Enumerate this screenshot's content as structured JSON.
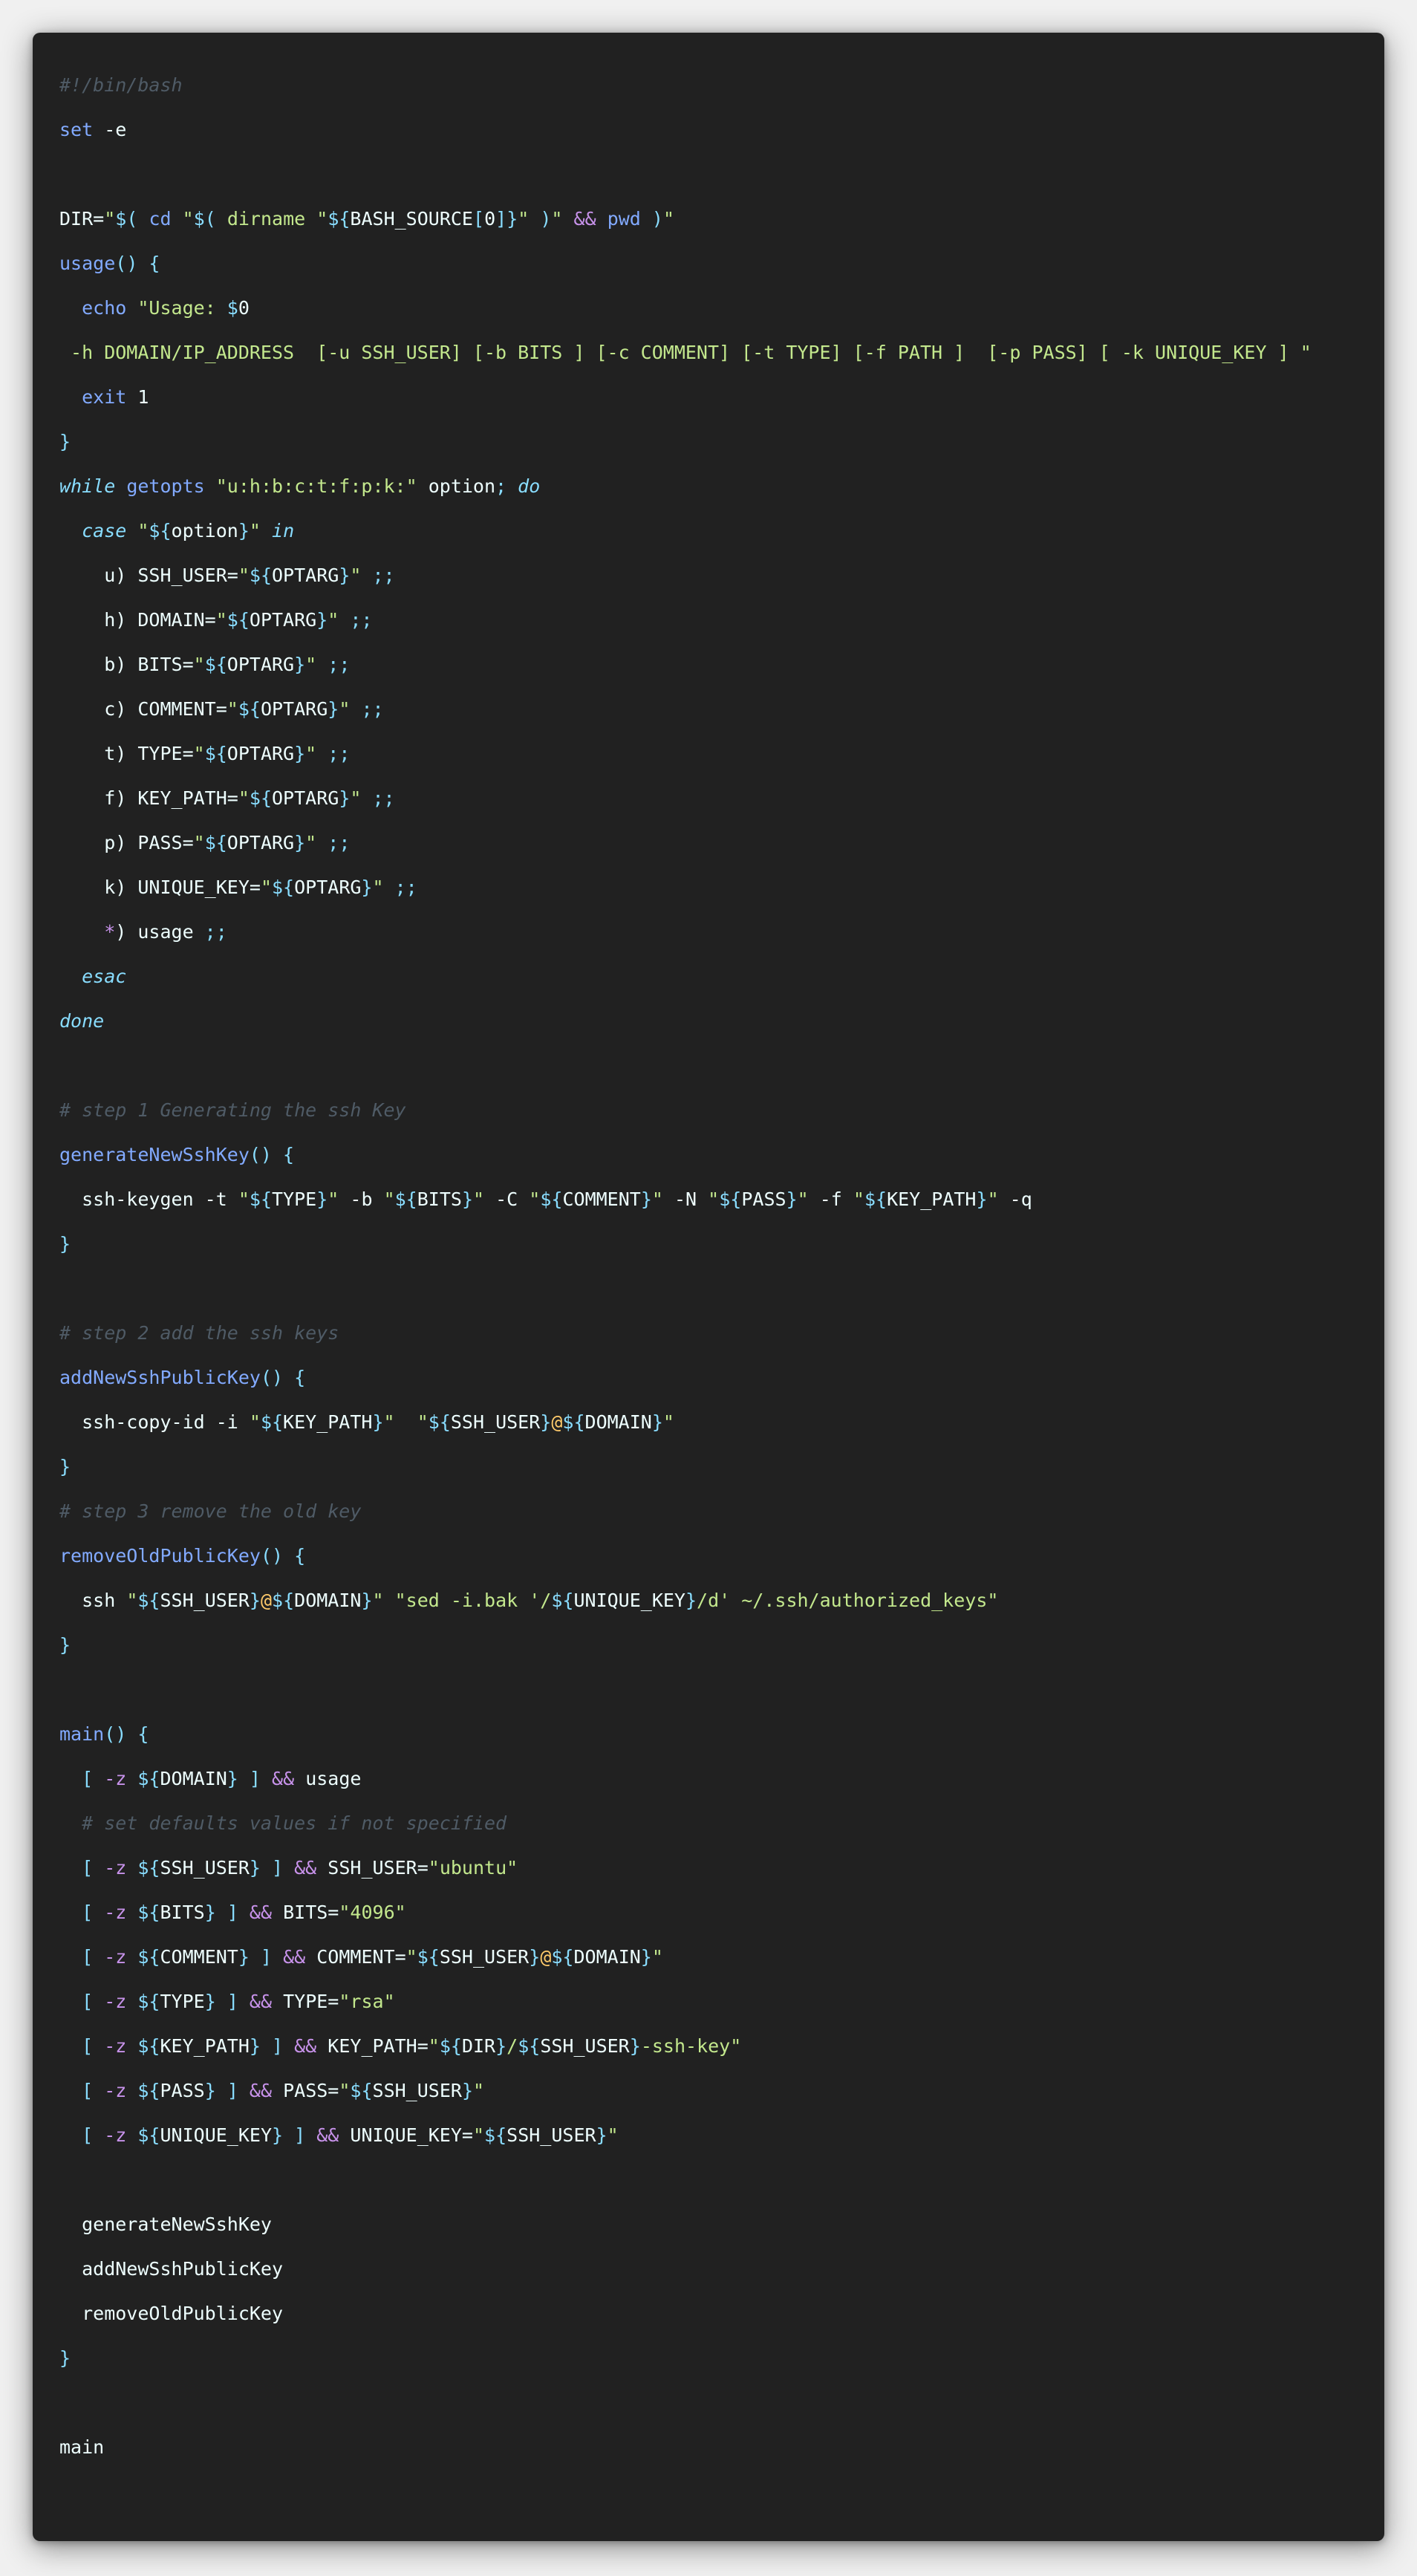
{
  "theme": {
    "background": "#f0f0f0",
    "editor_background": "#212121",
    "plain": "#eeffff",
    "comment": "#4f5b66",
    "keyword": "#89ddff",
    "function": "#82aaff",
    "string": "#c3e88d",
    "variable": "#89ddff",
    "operator": "#c792ea",
    "at_sign": "#ffcb6b"
  },
  "code_lines": [
    [
      [
        "comment",
        "#!/bin/bash"
      ]
    ],
    [
      [
        "func",
        "set"
      ],
      [
        "plain",
        " -e"
      ]
    ],
    [],
    [
      [
        "plain",
        "DIR="
      ],
      [
        "string",
        "\""
      ],
      [
        "var",
        "$("
      ],
      [
        "func",
        " cd "
      ],
      [
        "string",
        "\""
      ],
      [
        "var",
        "$("
      ],
      [
        "string",
        " dirname "
      ],
      [
        "string",
        "\""
      ],
      [
        "var",
        "${"
      ],
      [
        "plain",
        "BASH_SOURCE"
      ],
      [
        "punct",
        "["
      ],
      [
        "plain",
        "0"
      ],
      [
        "punct",
        "]"
      ],
      [
        "var",
        "}"
      ],
      [
        "string",
        "\""
      ],
      [
        "var",
        " )"
      ],
      [
        "string",
        "\""
      ],
      [
        "op",
        " && "
      ],
      [
        "func",
        "pwd"
      ],
      [
        "var",
        " )"
      ],
      [
        "string",
        "\""
      ]
    ],
    [
      [
        "func",
        "usage"
      ],
      [
        "punct",
        "() {"
      ]
    ],
    [
      [
        "func",
        "  echo"
      ],
      [
        "string",
        " \"Usage: "
      ],
      [
        "var",
        "$"
      ],
      [
        "plain",
        "0"
      ]
    ],
    [
      [
        "string",
        " -h DOMAIN/IP_ADDRESS  [-u SSH_USER] [-b BITS ] [-c COMMENT] [-t TYPE] [-f PATH ]  [-p PASS] [ -k UNIQUE_KEY ] \""
      ]
    ],
    [
      [
        "func",
        "  exit"
      ],
      [
        "plain",
        " 1"
      ]
    ],
    [
      [
        "punct",
        "}"
      ]
    ],
    [
      [
        "keyword",
        "while"
      ],
      [
        "func",
        " getopts"
      ],
      [
        "string",
        " \"u:h:b:c:t:f:p:k:\""
      ],
      [
        "plain",
        " option"
      ],
      [
        "punct",
        ";"
      ],
      [
        "keyword",
        " do"
      ]
    ],
    [
      [
        "keyword",
        "  case"
      ],
      [
        "string",
        " \""
      ],
      [
        "var",
        "${"
      ],
      [
        "plain",
        "option"
      ],
      [
        "var",
        "}"
      ],
      [
        "string",
        "\""
      ],
      [
        "keyword",
        " in"
      ]
    ],
    [
      [
        "plain",
        "    u) SSH_USER="
      ],
      [
        "string",
        "\""
      ],
      [
        "var",
        "${"
      ],
      [
        "plain",
        "OPTARG"
      ],
      [
        "var",
        "}"
      ],
      [
        "string",
        "\""
      ],
      [
        "punct",
        " ;;"
      ]
    ],
    [
      [
        "plain",
        "    h) DOMAIN="
      ],
      [
        "string",
        "\""
      ],
      [
        "var",
        "${"
      ],
      [
        "plain",
        "OPTARG"
      ],
      [
        "var",
        "}"
      ],
      [
        "string",
        "\""
      ],
      [
        "punct",
        " ;;"
      ]
    ],
    [
      [
        "plain",
        "    b) BITS="
      ],
      [
        "string",
        "\""
      ],
      [
        "var",
        "${"
      ],
      [
        "plain",
        "OPTARG"
      ],
      [
        "var",
        "}"
      ],
      [
        "string",
        "\""
      ],
      [
        "punct",
        " ;;"
      ]
    ],
    [
      [
        "plain",
        "    c) COMMENT="
      ],
      [
        "string",
        "\""
      ],
      [
        "var",
        "${"
      ],
      [
        "plain",
        "OPTARG"
      ],
      [
        "var",
        "}"
      ],
      [
        "string",
        "\""
      ],
      [
        "punct",
        " ;;"
      ]
    ],
    [
      [
        "plain",
        "    t) TYPE="
      ],
      [
        "string",
        "\""
      ],
      [
        "var",
        "${"
      ],
      [
        "plain",
        "OPTARG"
      ],
      [
        "var",
        "}"
      ],
      [
        "string",
        "\""
      ],
      [
        "punct",
        " ;;"
      ]
    ],
    [
      [
        "plain",
        "    f) KEY_PATH="
      ],
      [
        "string",
        "\""
      ],
      [
        "var",
        "${"
      ],
      [
        "plain",
        "OPTARG"
      ],
      [
        "var",
        "}"
      ],
      [
        "string",
        "\""
      ],
      [
        "punct",
        " ;;"
      ]
    ],
    [
      [
        "plain",
        "    p) PASS="
      ],
      [
        "string",
        "\""
      ],
      [
        "var",
        "${"
      ],
      [
        "plain",
        "OPTARG"
      ],
      [
        "var",
        "}"
      ],
      [
        "string",
        "\""
      ],
      [
        "punct",
        " ;;"
      ]
    ],
    [
      [
        "plain",
        "    k) UNIQUE_KEY="
      ],
      [
        "string",
        "\""
      ],
      [
        "var",
        "${"
      ],
      [
        "plain",
        "OPTARG"
      ],
      [
        "var",
        "}"
      ],
      [
        "string",
        "\""
      ],
      [
        "punct",
        " ;;"
      ]
    ],
    [
      [
        "op",
        "    *"
      ],
      [
        "plain",
        ") usage"
      ],
      [
        "punct",
        " ;;"
      ]
    ],
    [
      [
        "keyword",
        "  esac"
      ]
    ],
    [
      [
        "keyword",
        "done"
      ]
    ],
    [],
    [
      [
        "comment",
        "# step 1 Generating the ssh Key"
      ]
    ],
    [
      [
        "func",
        "generateNewSshKey"
      ],
      [
        "punct",
        "() {"
      ]
    ],
    [
      [
        "plain",
        "  ssh-keygen -t "
      ],
      [
        "string",
        "\""
      ],
      [
        "var",
        "${"
      ],
      [
        "plain",
        "TYPE"
      ],
      [
        "var",
        "}"
      ],
      [
        "string",
        "\""
      ],
      [
        "plain",
        " -b "
      ],
      [
        "string",
        "\""
      ],
      [
        "var",
        "${"
      ],
      [
        "plain",
        "BITS"
      ],
      [
        "var",
        "}"
      ],
      [
        "string",
        "\""
      ],
      [
        "plain",
        " -C "
      ],
      [
        "string",
        "\""
      ],
      [
        "var",
        "${"
      ],
      [
        "plain",
        "COMMENT"
      ],
      [
        "var",
        "}"
      ],
      [
        "string",
        "\""
      ],
      [
        "plain",
        " -N "
      ],
      [
        "string",
        "\""
      ],
      [
        "var",
        "${"
      ],
      [
        "plain",
        "PASS"
      ],
      [
        "var",
        "}"
      ],
      [
        "string",
        "\""
      ],
      [
        "plain",
        " -f "
      ],
      [
        "string",
        "\""
      ],
      [
        "var",
        "${"
      ],
      [
        "plain",
        "KEY_PATH"
      ],
      [
        "var",
        "}"
      ],
      [
        "string",
        "\""
      ],
      [
        "plain",
        " -q"
      ]
    ],
    [
      [
        "punct",
        "}"
      ]
    ],
    [],
    [
      [
        "comment",
        "# step 2 add the ssh keys"
      ]
    ],
    [
      [
        "func",
        "addNewSshPublicKey"
      ],
      [
        "punct",
        "() {"
      ]
    ],
    [
      [
        "plain",
        "  ssh-copy-id -i "
      ],
      [
        "string",
        "\""
      ],
      [
        "var",
        "${"
      ],
      [
        "plain",
        "KEY_PATH"
      ],
      [
        "var",
        "}"
      ],
      [
        "string",
        "\""
      ],
      [
        "plain",
        "  "
      ],
      [
        "string",
        "\""
      ],
      [
        "var",
        "${"
      ],
      [
        "plain",
        "SSH_USER"
      ],
      [
        "var",
        "}"
      ],
      [
        "at",
        "@"
      ],
      [
        "var",
        "${"
      ],
      [
        "plain",
        "DOMAIN"
      ],
      [
        "var",
        "}"
      ],
      [
        "string",
        "\""
      ]
    ],
    [
      [
        "punct",
        "}"
      ]
    ],
    [
      [
        "comment",
        "# step 3 remove the old key"
      ]
    ],
    [
      [
        "func",
        "removeOldPublicKey"
      ],
      [
        "punct",
        "() {"
      ]
    ],
    [
      [
        "plain",
        "  ssh "
      ],
      [
        "string",
        "\""
      ],
      [
        "var",
        "${"
      ],
      [
        "plain",
        "SSH_USER"
      ],
      [
        "var",
        "}"
      ],
      [
        "at",
        "@"
      ],
      [
        "var",
        "${"
      ],
      [
        "plain",
        "DOMAIN"
      ],
      [
        "var",
        "}"
      ],
      [
        "string",
        "\""
      ],
      [
        "string",
        " \"sed -i.bak '/"
      ],
      [
        "var",
        "${"
      ],
      [
        "plain",
        "UNIQUE_KEY"
      ],
      [
        "var",
        "}"
      ],
      [
        "string",
        "/d' ~/.ssh/authorized_keys\""
      ]
    ],
    [
      [
        "punct",
        "}"
      ]
    ],
    [],
    [
      [
        "func",
        "main"
      ],
      [
        "punct",
        "() {"
      ]
    ],
    [
      [
        "punct",
        "  ["
      ],
      [
        "op",
        " -z "
      ],
      [
        "var",
        "${"
      ],
      [
        "plain",
        "DOMAIN"
      ],
      [
        "var",
        "}"
      ],
      [
        "punct",
        " ]"
      ],
      [
        "op",
        " && "
      ],
      [
        "plain",
        "usage"
      ]
    ],
    [
      [
        "comment",
        "  # set defaults values if not specified"
      ]
    ],
    [
      [
        "punct",
        "  ["
      ],
      [
        "op",
        " -z "
      ],
      [
        "var",
        "${"
      ],
      [
        "plain",
        "SSH_USER"
      ],
      [
        "var",
        "}"
      ],
      [
        "punct",
        " ]"
      ],
      [
        "op",
        " && "
      ],
      [
        "plain",
        "SSH_USER="
      ],
      [
        "string",
        "\"ubuntu\""
      ]
    ],
    [
      [
        "punct",
        "  ["
      ],
      [
        "op",
        " -z "
      ],
      [
        "var",
        "${"
      ],
      [
        "plain",
        "BITS"
      ],
      [
        "var",
        "}"
      ],
      [
        "punct",
        " ]"
      ],
      [
        "op",
        " && "
      ],
      [
        "plain",
        "BITS="
      ],
      [
        "string",
        "\"4096\""
      ]
    ],
    [
      [
        "punct",
        "  ["
      ],
      [
        "op",
        " -z "
      ],
      [
        "var",
        "${"
      ],
      [
        "plain",
        "COMMENT"
      ],
      [
        "var",
        "}"
      ],
      [
        "punct",
        " ]"
      ],
      [
        "op",
        " && "
      ],
      [
        "plain",
        "COMMENT="
      ],
      [
        "string",
        "\""
      ],
      [
        "var",
        "${"
      ],
      [
        "plain",
        "SSH_USER"
      ],
      [
        "var",
        "}"
      ],
      [
        "at",
        "@"
      ],
      [
        "var",
        "${"
      ],
      [
        "plain",
        "DOMAIN"
      ],
      [
        "var",
        "}"
      ],
      [
        "string",
        "\""
      ]
    ],
    [
      [
        "punct",
        "  ["
      ],
      [
        "op",
        " -z "
      ],
      [
        "var",
        "${"
      ],
      [
        "plain",
        "TYPE"
      ],
      [
        "var",
        "}"
      ],
      [
        "punct",
        " ]"
      ],
      [
        "op",
        " && "
      ],
      [
        "plain",
        "TYPE="
      ],
      [
        "string",
        "\"rsa\""
      ]
    ],
    [
      [
        "punct",
        "  ["
      ],
      [
        "op",
        " -z "
      ],
      [
        "var",
        "${"
      ],
      [
        "plain",
        "KEY_PATH"
      ],
      [
        "var",
        "}"
      ],
      [
        "punct",
        " ]"
      ],
      [
        "op",
        " && "
      ],
      [
        "plain",
        "KEY_PATH="
      ],
      [
        "string",
        "\""
      ],
      [
        "var",
        "${"
      ],
      [
        "plain",
        "DIR"
      ],
      [
        "var",
        "}"
      ],
      [
        "string",
        "/"
      ],
      [
        "var",
        "${"
      ],
      [
        "plain",
        "SSH_USER"
      ],
      [
        "var",
        "}"
      ],
      [
        "string",
        "-ssh-key\""
      ]
    ],
    [
      [
        "punct",
        "  ["
      ],
      [
        "op",
        " -z "
      ],
      [
        "var",
        "${"
      ],
      [
        "plain",
        "PASS"
      ],
      [
        "var",
        "}"
      ],
      [
        "punct",
        " ]"
      ],
      [
        "op",
        " && "
      ],
      [
        "plain",
        "PASS="
      ],
      [
        "string",
        "\""
      ],
      [
        "var",
        "${"
      ],
      [
        "plain",
        "SSH_USER"
      ],
      [
        "var",
        "}"
      ],
      [
        "string",
        "\""
      ]
    ],
    [
      [
        "punct",
        "  ["
      ],
      [
        "op",
        " -z "
      ],
      [
        "var",
        "${"
      ],
      [
        "plain",
        "UNIQUE_KEY"
      ],
      [
        "var",
        "}"
      ],
      [
        "punct",
        " ]"
      ],
      [
        "op",
        " && "
      ],
      [
        "plain",
        "UNIQUE_KEY="
      ],
      [
        "string",
        "\""
      ],
      [
        "var",
        "${"
      ],
      [
        "plain",
        "SSH_USER"
      ],
      [
        "var",
        "}"
      ],
      [
        "string",
        "\""
      ]
    ],
    [],
    [
      [
        "plain",
        "  generateNewSshKey"
      ]
    ],
    [
      [
        "plain",
        "  addNewSshPublicKey"
      ]
    ],
    [
      [
        "plain",
        "  removeOldPublicKey"
      ]
    ],
    [
      [
        "punct",
        "}"
      ]
    ],
    [],
    [
      [
        "plain",
        "main"
      ]
    ]
  ]
}
